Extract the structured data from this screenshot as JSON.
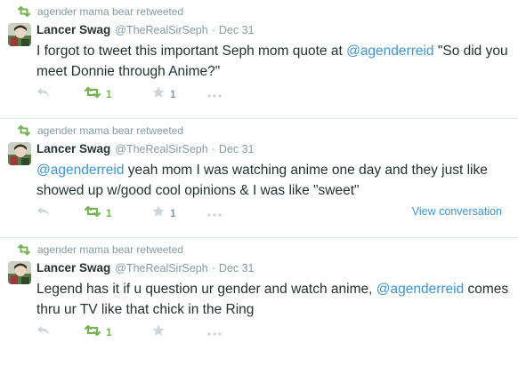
{
  "tweets": [
    {
      "retweeter_line": "agender mama bear retweeted",
      "name": "Lancer Swag",
      "handle": "@TheRealSirSeph",
      "dot": "·",
      "date": "Dec 31",
      "text_parts": [
        {
          "text": "I forgot to tweet this important Seph mom quote at ",
          "mention": false
        },
        {
          "text": "@agenderreid",
          "mention": true
        },
        {
          "text": " \"So did you meet Donnie through Anime?\"",
          "mention": false
        }
      ],
      "retweet_count": "1",
      "favorite_count": "1",
      "view_conversation": ""
    },
    {
      "retweeter_line": "agender mama bear retweeted",
      "name": "Lancer Swag",
      "handle": "@TheRealSirSeph",
      "dot": "·",
      "date": "Dec 31",
      "text_parts": [
        {
          "text": "@agenderreid",
          "mention": true
        },
        {
          "text": " yeah mom I was watching anime one day and they just like showed up w/good cool opinions & I was like \"sweet\"",
          "mention": false
        }
      ],
      "retweet_count": "1",
      "favorite_count": "1",
      "view_conversation": "View conversation"
    },
    {
      "retweeter_line": "agender mama bear retweeted",
      "name": "Lancer Swag",
      "handle": "@TheRealSirSeph",
      "dot": "·",
      "date": "Dec 31",
      "text_parts": [
        {
          "text": "Legend has it if u question ur gender and watch anime, ",
          "mention": false
        },
        {
          "text": "@agenderreid",
          "mention": true
        },
        {
          "text": " comes thru ur TV like that chick in the Ring",
          "mention": false
        }
      ],
      "retweet_count": "1",
      "favorite_count": "",
      "view_conversation": ""
    }
  ],
  "colors": {
    "retweet_green": "#77b255",
    "link_blue": "#3b94d9",
    "muted_gray": "#8899a6",
    "icon_gray": "#ccd6dd",
    "text": "#292f33"
  },
  "icons": {
    "retweeted_indicator": "retweet-icon",
    "reply": "reply-icon",
    "retweet": "retweet-icon",
    "favorite": "star-icon",
    "more": "more-icon"
  }
}
